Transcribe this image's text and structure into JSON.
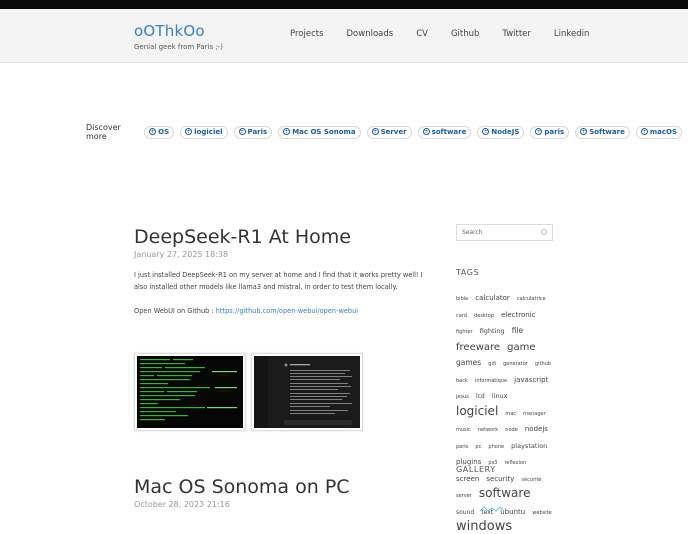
{
  "site": {
    "title": "oOThkOo",
    "tagline": "Genial geek from Paris ;-)"
  },
  "nav": [
    "Projects",
    "Downloads",
    "CV",
    "Github",
    "Twitter",
    "Linkedin"
  ],
  "discover": {
    "label": "Discover more",
    "tags": [
      "OS",
      "logiciel",
      "Paris",
      "Mac OS Sonoma",
      "Server",
      "software",
      "NodeJS",
      "paris",
      "Software",
      "macOS"
    ]
  },
  "posts": [
    {
      "title": "DeepSeek-R1 At Home",
      "date": "January 27, 2025 18:38",
      "body": "I just installed DeepSeek-R1 on my server at home and I find that it works pretty well! I also installed other models like llama3 and mistral, in order to test them locally.",
      "link_prefix": "Open WebUI on Github : ",
      "link_text": "https://github.com/open-webui/open-webui"
    },
    {
      "title": "Mac OS Sonoma on PC",
      "date": "October 28, 2023 21:16"
    }
  ],
  "sidebar": {
    "search_placeholder": "Search",
    "tags_heading": "TAGS",
    "gallery_heading": "GALLERY",
    "tags": [
      {
        "t": "bible",
        "s": 5
      },
      {
        "t": "calculator",
        "s": 7
      },
      {
        "t": "calculatrice",
        "s": 5
      },
      {
        "t": "card",
        "s": 5
      },
      {
        "t": "desktop",
        "s": 5
      },
      {
        "t": "electronic",
        "s": 7
      },
      {
        "t": "fighter",
        "s": 5
      },
      {
        "t": "fighting",
        "s": 6.5
      },
      {
        "t": "file",
        "s": 7.5
      },
      {
        "t": "freeware",
        "s": 10
      },
      {
        "t": "game",
        "s": 10
      },
      {
        "t": "games",
        "s": 7.5
      },
      {
        "t": "gdi",
        "s": 5
      },
      {
        "t": "generator",
        "s": 5
      },
      {
        "t": "github",
        "s": 5
      },
      {
        "t": "hack",
        "s": 5
      },
      {
        "t": "informatique",
        "s": 5
      },
      {
        "t": "javascript",
        "s": 7
      },
      {
        "t": "jesus",
        "s": 5
      },
      {
        "t": "lcd",
        "s": 6
      },
      {
        "t": "linux",
        "s": 6.5
      },
      {
        "t": "logiciel",
        "s": 12
      },
      {
        "t": "mac",
        "s": 5
      },
      {
        "t": "manager",
        "s": 5
      },
      {
        "t": "music",
        "s": 5
      },
      {
        "t": "network",
        "s": 5
      },
      {
        "t": "node",
        "s": 5
      },
      {
        "t": "nodejs",
        "s": 7
      },
      {
        "t": "paris",
        "s": 5
      },
      {
        "t": "pc",
        "s": 5
      },
      {
        "t": "phone",
        "s": 5
      },
      {
        "t": "playstation",
        "s": 6.5
      },
      {
        "t": "plugins",
        "s": 7
      },
      {
        "t": "ps3",
        "s": 5
      },
      {
        "t": "reflexion",
        "s": 5
      },
      {
        "t": "screen",
        "s": 7
      },
      {
        "t": "security",
        "s": 7
      },
      {
        "t": "sécurité",
        "s": 5
      },
      {
        "t": "server",
        "s": 5
      },
      {
        "t": "software",
        "s": 12
      },
      {
        "t": "sound",
        "s": 6
      },
      {
        "t": "text",
        "s": 6
      },
      {
        "t": "ubuntu",
        "s": 7
      },
      {
        "t": "website",
        "s": 5
      },
      {
        "t": "windows",
        "s": 13
      }
    ]
  }
}
